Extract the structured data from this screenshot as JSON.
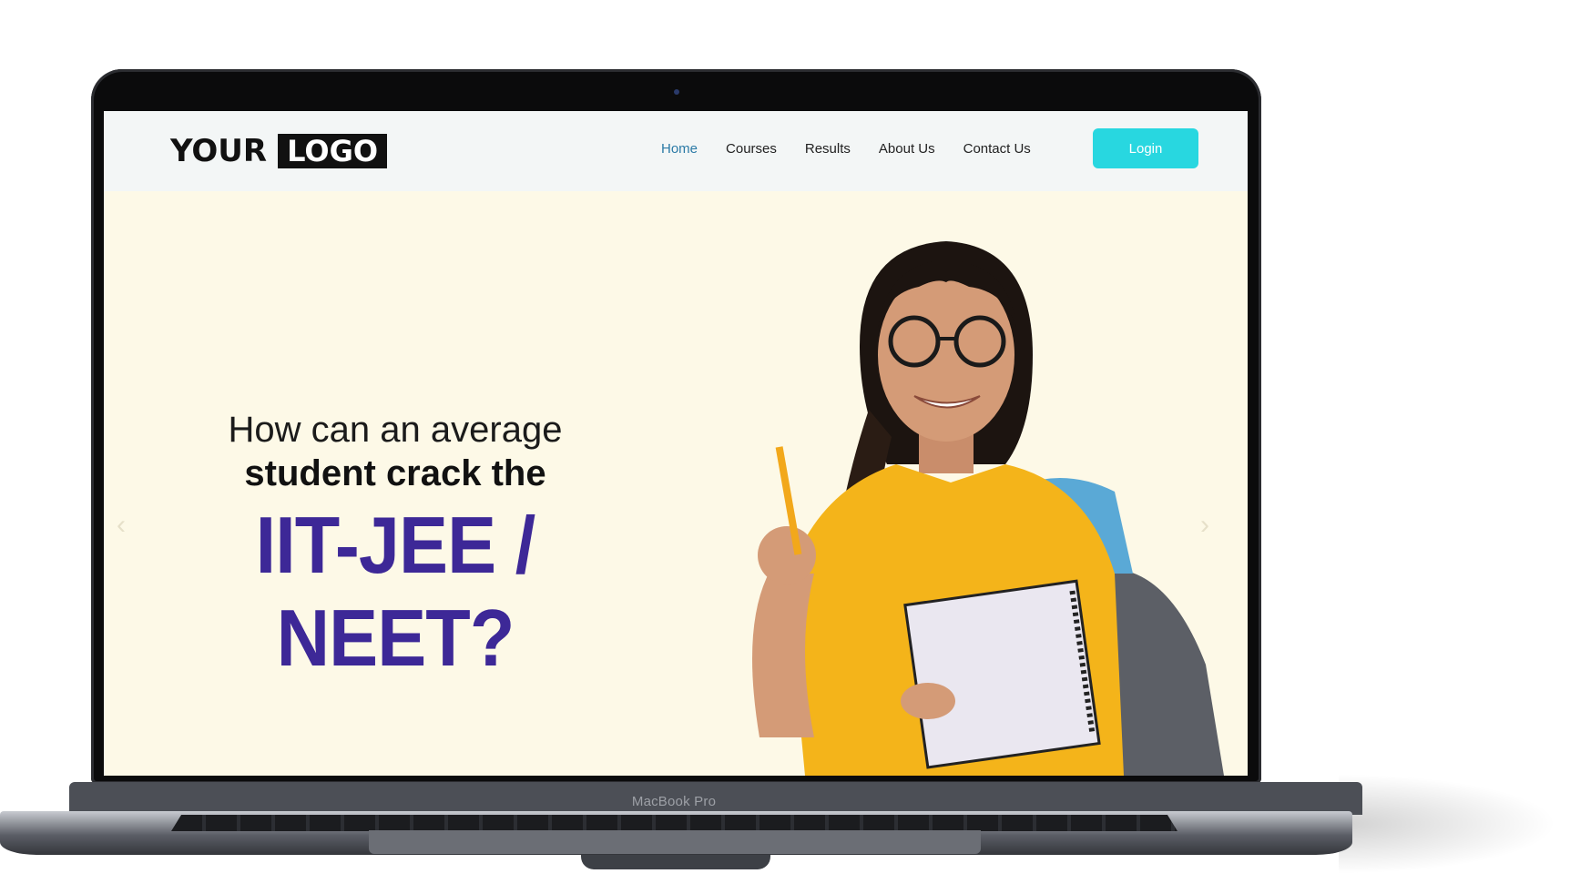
{
  "device": {
    "brand_label": "MacBook Pro"
  },
  "nav": {
    "logo_word1": "YOUR",
    "logo_word2": "LOGO",
    "items": [
      {
        "label": "Home",
        "active": true
      },
      {
        "label": "Courses",
        "active": false
      },
      {
        "label": "Results",
        "active": false
      },
      {
        "label": "About Us",
        "active": false
      },
      {
        "label": "Contact Us",
        "active": false
      }
    ],
    "login_label": "Login"
  },
  "hero": {
    "line1": "How can an average",
    "line2": "student crack the",
    "line3": "IIT-JEE / NEET?",
    "prev_icon": "‹",
    "next_icon": "›"
  },
  "colors": {
    "accent": "#28d7e0",
    "active_link": "#2b7aa6",
    "headline": "#3d2897",
    "hero_bg": "#fdf9e7"
  }
}
